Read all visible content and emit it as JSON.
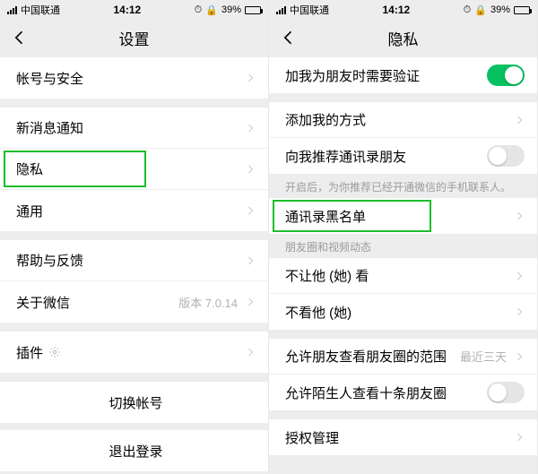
{
  "left": {
    "status": {
      "carrier": "中国联通",
      "time": "14:12",
      "battery": "39%"
    },
    "nav": {
      "title": "设置"
    },
    "groups": {
      "g1": {
        "account": "帐号与安全"
      },
      "g2": {
        "notify": "新消息通知",
        "privacy": "隐私",
        "general": "通用"
      },
      "g3": {
        "help": "帮助与反馈",
        "about": "关于微信",
        "about_side": "版本 7.0.14"
      },
      "g4": {
        "plugins": "插件"
      },
      "g5": {
        "switch_acc": "切换帐号",
        "logout": "退出登录"
      }
    }
  },
  "right": {
    "status": {
      "carrier": "中国联通",
      "time": "14:12",
      "battery": "39%"
    },
    "nav": {
      "title": "隐私"
    },
    "rows": {
      "need_verify": "加我为朋友时需要验证",
      "add_methods": "添加我的方式",
      "recommend": "向我推荐通讯录朋友",
      "recommend_hint": "开启后，为你推荐已经开通微信的手机联系人。",
      "blacklist": "通讯录黑名单",
      "section_moments": "朋友圈和视频动态",
      "block_out": "不让他 (她) 看",
      "block_in": "不看他 (她)",
      "moments_range": "允许朋友查看朋友圈的范围",
      "moments_range_val": "最近三天",
      "stranger_ten": "允许陌生人查看十条朋友圈",
      "auth_mgmt": "授权管理"
    }
  }
}
